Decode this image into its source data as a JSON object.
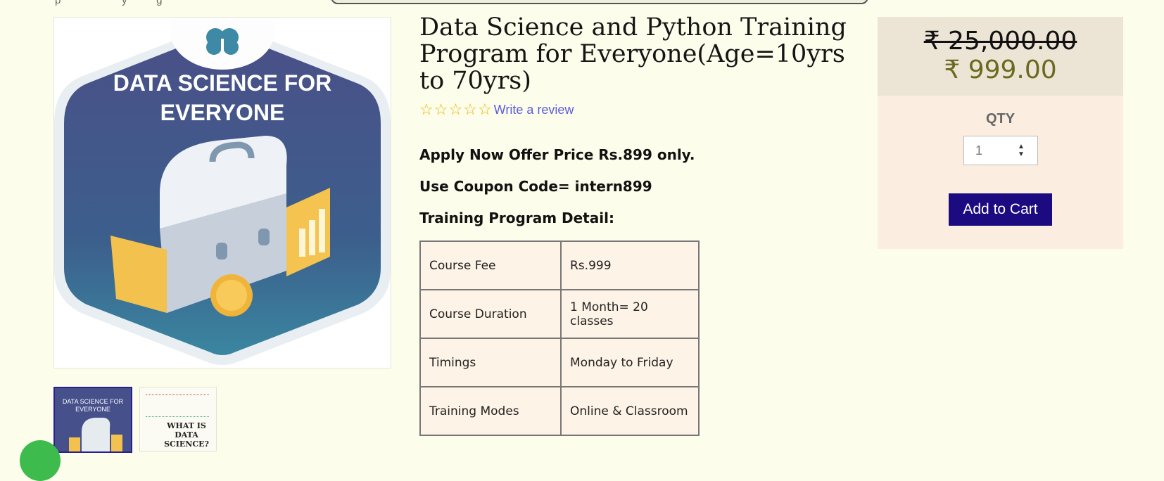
{
  "breadcrumb": {
    "text": "p            y      g"
  },
  "product": {
    "title": "Data Science and Python Training Program for Everyone(Age=10yrs to 70yrs)",
    "image_text": [
      "DATA SCIENCE FOR",
      "EVERYONE"
    ],
    "thumb1_text": [
      "DATA SCIENCE FOR",
      "EVERYONE"
    ],
    "thumb2_text": [
      "WHAT IS",
      "DATA SCIENCE?"
    ],
    "rating": {
      "stars": 5,
      "filled": 0,
      "review_link": "Write a review"
    },
    "offer": "Apply Now Offer Price Rs.899 only.",
    "coupon": "Use Coupon Code= intern899",
    "detail_heading": "Training Program Detail:",
    "details": [
      {
        "label": "Course Fee",
        "value": " Rs.999"
      },
      {
        "label": "Course Duration",
        "value": "1 Month= 20 classes"
      },
      {
        "label": "Timings",
        "value": "Monday to Friday"
      },
      {
        "label": "Training Modes",
        "value": "Online & Classroom"
      }
    ]
  },
  "pricing": {
    "old_price": "₹ 25,000.00",
    "new_price": "₹ 999.00",
    "qty_label": "QTY",
    "qty_value": "1",
    "add_to_cart": "Add to Cart"
  },
  "colors": {
    "background": "#fdfdec",
    "accent_button": "#1c0a80",
    "new_price": "#6a6a1e",
    "link": "#5b5bdc",
    "star": "#e6b800"
  },
  "icons": [
    "brain-icon",
    "star-outline-icon",
    "spinner-up-icon",
    "spinner-down-icon"
  ]
}
